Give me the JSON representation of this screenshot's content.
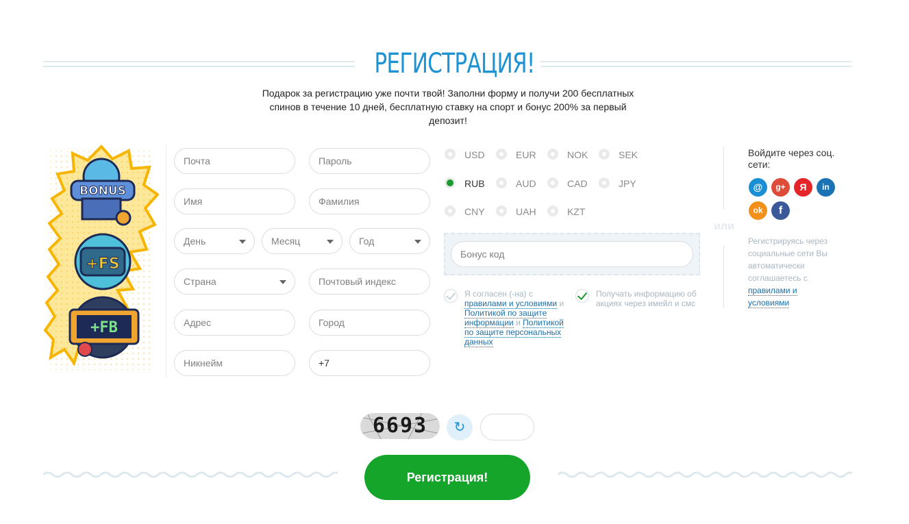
{
  "header": {
    "title": "РЕГИСТРАЦИЯ!",
    "subtitle": "Подарок за регистрацию уже почти твой! Заполни форму и получи 200 бесплатных спинов в течение 10 дней, бесплатную ставку на спорт и бонус 200% за первый депозит!"
  },
  "illustration": {
    "badges": [
      "BONUS",
      "+FS",
      "+FB"
    ]
  },
  "form": {
    "email_placeholder": "Почта",
    "password_placeholder": "Пароль",
    "first_name_placeholder": "Имя",
    "last_name_placeholder": "Фамилия",
    "day_label": "День",
    "month_label": "Месяц",
    "year_label": "Год",
    "country_label": "Страна",
    "postal_placeholder": "Почтовый индекс",
    "address_placeholder": "Адрес",
    "city_placeholder": "Город",
    "nickname_placeholder": "Никнейм",
    "phone_value": "+7"
  },
  "currencies": [
    {
      "code": "USD",
      "selected": false
    },
    {
      "code": "EUR",
      "selected": false
    },
    {
      "code": "NOK",
      "selected": false
    },
    {
      "code": "SEK",
      "selected": false
    },
    {
      "code": "RUB",
      "selected": true
    },
    {
      "code": "AUD",
      "selected": false
    },
    {
      "code": "CAD",
      "selected": false
    },
    {
      "code": "JPY",
      "selected": false
    },
    {
      "code": "CNY",
      "selected": false
    },
    {
      "code": "UAH",
      "selected": false
    },
    {
      "code": "KZT",
      "selected": false
    }
  ],
  "bonus": {
    "placeholder": "Бонус код"
  },
  "agreements": {
    "terms_prefix": "Я согласен (-на) с",
    "terms_link": "правилами и условиями",
    "and1": "и",
    "privacy_link": "Политикой по защите информации",
    "and2": "и",
    "personal_link": "Политикой по защите персональных данных",
    "terms_checked": false,
    "news_text": "Получать информацию об акциях через имейл и смс",
    "news_checked": true
  },
  "divider": {
    "or_label": "или"
  },
  "social": {
    "title": "Войдите через соц. сети:",
    "networks": [
      {
        "icon": "mail-icon",
        "glyph": "@",
        "color": "#1a8fd4"
      },
      {
        "icon": "google-plus-icon",
        "glyph": "g+",
        "color": "#dd4b39"
      },
      {
        "icon": "yandex-icon",
        "glyph": "Я",
        "color": "#e4262a"
      },
      {
        "icon": "linkedin-icon",
        "glyph": "in",
        "color": "#1b73b3"
      },
      {
        "icon": "odnoklassniki-icon",
        "glyph": "ok",
        "color": "#f39019"
      },
      {
        "icon": "facebook-icon",
        "glyph": "f",
        "color": "#3b5998"
      }
    ],
    "note_text": "Регистрируясь через социальные сети Вы автоматически соглашаетесь с",
    "note_link": "правилами и условиями"
  },
  "captcha": {
    "code": "6693",
    "refresh_icon": "refresh-icon"
  },
  "submit": {
    "label": "Регистрация!"
  }
}
